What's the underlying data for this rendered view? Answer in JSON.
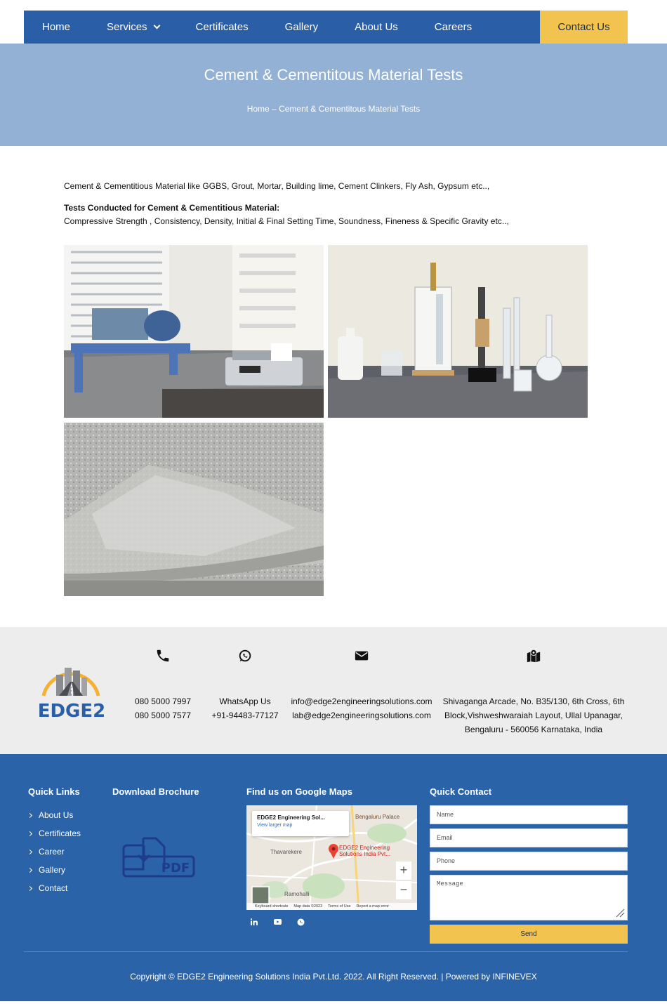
{
  "nav": {
    "items": [
      {
        "label": "Home"
      },
      {
        "label": "Services"
      },
      {
        "label": "Certificates"
      },
      {
        "label": "Gallery"
      },
      {
        "label": "About Us"
      },
      {
        "label": "Careers"
      }
    ],
    "cta_label": "Contact Us"
  },
  "hero": {
    "title": "Cement & Cementitous Material Tests",
    "breadcrumb": "Home – Cement & Cementitous Material Tests"
  },
  "content": {
    "intro": "Cement & Cementitious Material like GGBS, Grout, Mortar, Building lime, Cement Clinkers, Fly Ash, Gypsum etc..,",
    "tests_heading": "Tests Conducted for Cement & Cementitious Material:",
    "tests_list": "Compressive Strength , Consistency, Density, Initial & Final Setting Time, Soundness, Fineness & Specific Gravity etc..,"
  },
  "contact_strip": {
    "phone1": "080 5000 7997",
    "phone2": "080 5000 7577",
    "whatsapp_label": "WhatsApp Us",
    "whatsapp_number": "+91-94483-77127",
    "email1": "info@edge2engineeringsolutions.com",
    "email2": "lab@edge2engineeringsolutions.com",
    "address1": "Shivaganga Arcade, No. B35/130, 6th Cross, 6th",
    "address2": "Block,Vishweshwaraiah Layout, Ullal Upanagar,",
    "address3": "Bengaluru - 560056 Karnataka, India",
    "logo_text": "EDGE2"
  },
  "footer": {
    "quick_links_heading": "Quick Links",
    "quick_links": [
      {
        "label": "About Us"
      },
      {
        "label": "Certificates"
      },
      {
        "label": "Career"
      },
      {
        "label": "Gallery"
      },
      {
        "label": "Contact"
      }
    ],
    "brochure_heading": "Download Brochure",
    "pdf_label": "PDF",
    "maps_heading": "Find us on Google Maps",
    "map": {
      "card_title": "EDGE2 Engineering Sol...",
      "card_link": "View larger map",
      "pin_line1": "EDGE2 Engineering",
      "pin_line2": "Solutions India Pvt...",
      "label_palace": "Bengaluru Palace",
      "label_thavarekere": "Thavarekere",
      "label_ramohalli": "Ramohalli",
      "zoom_in": "+",
      "zoom_out": "−",
      "shortcuts": "Keyboard shortcuts",
      "map_data": "Map data ©2023",
      "terms": "Terms of Use",
      "report": "Report a map error"
    },
    "contact_heading": "Quick Contact",
    "form": {
      "name_placeholder": "Name",
      "email_placeholder": "Email",
      "phone_placeholder": "Phone",
      "message_placeholder": "Message",
      "send_label": "Send"
    },
    "copyright": "Copyright © EDGE2 Engineering Solutions India Pvt.Ltd. 2022. All Right Reserved. | Powered by INFINEVEX"
  },
  "colors": {
    "nav_bg": "#2a5ea7",
    "accent": "#f3c34f",
    "hero_bg": "#93b0d5",
    "footer_bg": "#2a63a7"
  }
}
